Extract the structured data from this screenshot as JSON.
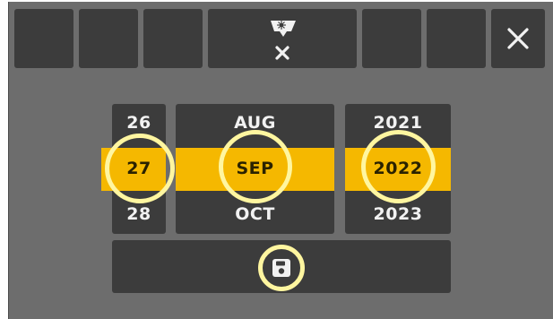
{
  "toolbar": {
    "center_icon": "brightness-off-icon",
    "close_icon": "close-icon"
  },
  "date_picker": {
    "day": {
      "prev": "26",
      "selected": "27",
      "next": "28"
    },
    "month": {
      "prev": "AUG",
      "selected": "SEP",
      "next": "OCT"
    },
    "year": {
      "prev": "2021",
      "selected": "2022",
      "next": "2023"
    }
  },
  "save": {
    "icon": "save-icon"
  },
  "colors": {
    "screen_bg": "#6d6d6d",
    "button_bg": "#3c3c3c",
    "selection_band": "#f5b800",
    "highlight_ring": "#fff6a0"
  }
}
